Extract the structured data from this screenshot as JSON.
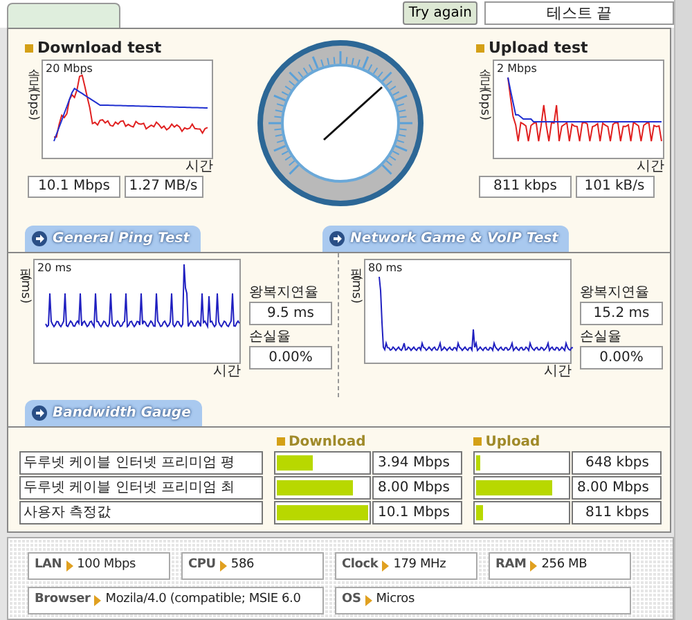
{
  "top_bar": {
    "try_again_button": "Try again",
    "status_field": "테스트 끝"
  },
  "throughput_tests": [
    {
      "title": "Download test",
      "graph_max": "20 Mbps",
      "y_label": "속도 (bps)",
      "x_label": "시간",
      "readings": [
        "10.1 Mbps",
        "1.27 MB/s"
      ],
      "kind": "download"
    },
    {
      "title": "Upload test",
      "graph_max": "2 Mbps",
      "y_label": "속도 (bps)",
      "x_label": "시간",
      "readings": [
        "811 kbps",
        "101 kB/s"
      ],
      "kind": "upload"
    }
  ],
  "ping_tests": [
    {
      "tab": "General Ping Test",
      "graph_max": "20 ms",
      "y_label": "핑 (ms)",
      "x_label": "시간",
      "latency_label": "왕복지연율",
      "latency": "9.5 ms",
      "loss_label": "손실율",
      "loss": "0.00%",
      "kind": "general"
    },
    {
      "tab": "Network Game & VoIP Test",
      "graph_max": "80 ms",
      "y_label": "핑 (ms)",
      "x_label": "시간",
      "latency_label": "왕복지연율",
      "latency": "15.2 ms",
      "loss_label": "손실율",
      "loss": "0.00%",
      "kind": "game"
    }
  ],
  "bandwidth": {
    "tab": "Bandwidth Gauge",
    "columns": [
      "Download",
      "Upload"
    ],
    "rows": [
      {
        "label": "두루넷 케이블 인터넷 프리미엄 평",
        "download": {
          "level": 0.4,
          "reading": "3.94 Mbps"
        },
        "upload": {
          "level": 0.05,
          "reading": "648 kbps"
        }
      },
      {
        "label": "두루넷 케이블 인터넷 프리미엄 최",
        "download": {
          "level": 0.83,
          "reading": "8.00 Mbps"
        },
        "upload": {
          "level": 0.83,
          "reading": "8.00 Mbps"
        }
      },
      {
        "label": "사용자 측정값",
        "download": {
          "level": 1.0,
          "reading": "10.1 Mbps"
        },
        "upload": {
          "level": 0.07,
          "reading": "811 kbps"
        }
      }
    ]
  },
  "system_info": [
    {
      "label": "LAN",
      "value": "100 Mbps"
    },
    {
      "label": "CPU",
      "value": "586"
    },
    {
      "label": "Clock",
      "value": "179 MHz"
    },
    {
      "label": "RAM",
      "value": "256 MB"
    },
    {
      "label": "Browser",
      "value": "Mozila/4.0 (compatible; MSIE 6.0"
    },
    {
      "label": "OS",
      "value": "Micros"
    }
  ]
}
